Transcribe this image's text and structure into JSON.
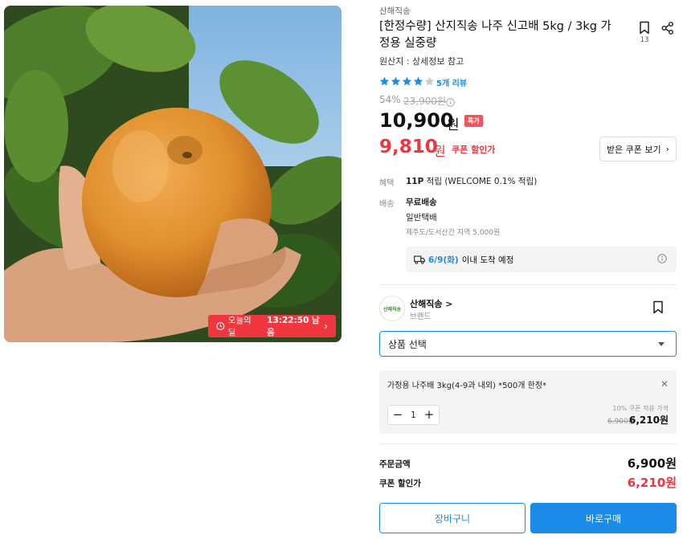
{
  "product": {
    "shop_name": "산해직송",
    "title": "[한정수량] 산지직송 나주 신고배 5kg / 3kg 가정용 실중량",
    "origin": "원산지 : 상세정보 참고",
    "bookmark_count": "13",
    "rating": 4,
    "review_link": "5개 리뷰",
    "discount_rate": "54%",
    "original_price": "23,900원",
    "sale_price": "10,900",
    "sale_unit": "원",
    "special_badge": "특가",
    "coupon_price": "9,810",
    "coupon_unit": "원",
    "coupon_label": "쿠폰 할인가",
    "coupon_button": "받은 쿠폰 보기"
  },
  "deal": {
    "label": "오늘의딜",
    "time_left": "13:22:50 남음"
  },
  "benefit": {
    "label": "혜택",
    "points": "11P",
    "points_text": "적립 (WELCOME 0.1% 적립)"
  },
  "shipping": {
    "label": "배송",
    "free": "무료배송",
    "type": "일반택배",
    "extra": "제주도/도서산간 지역 5,000원",
    "arrival_date": "6/9(화)",
    "arrival_text": "이내 도착 예정"
  },
  "brand": {
    "logo_text": "산해직송",
    "name": "산해직송 >",
    "sub": "브랜드"
  },
  "option_select": {
    "placeholder": "상품 선택"
  },
  "selected_option": {
    "name": "가정용 나주배 3kg(4-9과 내외) *500개 한정*",
    "quantity": "1",
    "coupon_label": "10% 쿠폰 적용 가격",
    "original_price": "6,900원",
    "final_price": "6,210원"
  },
  "totals": {
    "order_label": "주문금액",
    "order_amount": "6,900원",
    "discount_label": "쿠폰 할인가",
    "discount_amount": "6,210원"
  },
  "actions": {
    "cart": "장바구니",
    "buy": "바로구매"
  },
  "colors": {
    "accent_blue": "#1c8be8",
    "sale_red": "#f0363f",
    "star_blue": "#1c8be8"
  }
}
